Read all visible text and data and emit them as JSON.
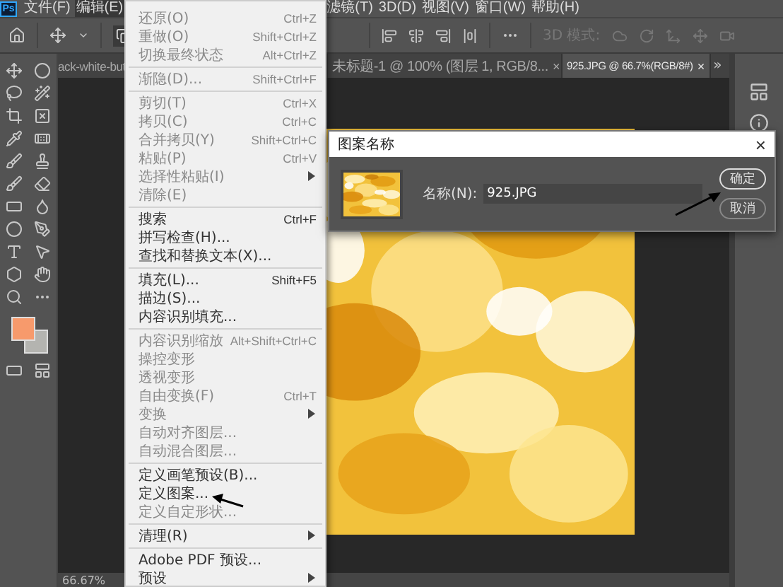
{
  "app_logo": "Ps",
  "menubar_left": [
    {
      "label": "文件(F)",
      "selected": false
    },
    {
      "label": "编辑(E)",
      "selected": true
    }
  ],
  "menubar_right": [
    {
      "label": "滤镜(T)",
      "selected": false
    },
    {
      "label": "3D(D)",
      "selected": false
    },
    {
      "label": "视图(V)",
      "selected": false
    },
    {
      "label": "窗口(W)",
      "selected": false
    },
    {
      "label": "帮助(H)",
      "selected": false
    }
  ],
  "options_bar": {
    "mode_label": "3D 模式:"
  },
  "tabs": [
    {
      "label": "ack-white-but",
      "selected": false
    },
    {
      "label": "未标题-1 @ 100% (图层 1, RGB/8...",
      "close": "×",
      "selected": false
    },
    {
      "label": "925.JPG @ 66.7%(RGB/8#)",
      "close": "×",
      "selected": true
    }
  ],
  "tab_overflow": "»",
  "status_bar": {
    "zoom": "66.67%"
  },
  "edit_menu": [
    {
      "kind": "item",
      "label": "还原(O)",
      "shortcut": "Ctrl+Z",
      "disabled": true
    },
    {
      "kind": "item",
      "label": "重做(O)",
      "shortcut": "Shift+Ctrl+Z",
      "disabled": true
    },
    {
      "kind": "item",
      "label": "切换最终状态",
      "shortcut": "Alt+Ctrl+Z",
      "disabled": true
    },
    {
      "kind": "separator"
    },
    {
      "kind": "item",
      "label": "渐隐(D)...",
      "shortcut": "Shift+Ctrl+F",
      "disabled": true
    },
    {
      "kind": "separator"
    },
    {
      "kind": "item",
      "label": "剪切(T)",
      "shortcut": "Ctrl+X",
      "disabled": true
    },
    {
      "kind": "item",
      "label": "拷贝(C)",
      "shortcut": "Ctrl+C",
      "disabled": true
    },
    {
      "kind": "item",
      "label": "合并拷贝(Y)",
      "shortcut": "Shift+Ctrl+C",
      "disabled": true
    },
    {
      "kind": "item",
      "label": "粘贴(P)",
      "shortcut": "Ctrl+V",
      "disabled": true
    },
    {
      "kind": "submenu",
      "label": "选择性粘贴(I)",
      "disabled": true
    },
    {
      "kind": "item",
      "label": "清除(E)",
      "disabled": true
    },
    {
      "kind": "separator"
    },
    {
      "kind": "item",
      "label": "搜索",
      "shortcut": "Ctrl+F",
      "disabled": false
    },
    {
      "kind": "item",
      "label": "拼写检查(H)...",
      "disabled": false
    },
    {
      "kind": "item",
      "label": "查找和替换文本(X)...",
      "disabled": false
    },
    {
      "kind": "separator"
    },
    {
      "kind": "item",
      "label": "填充(L)...",
      "shortcut": "Shift+F5",
      "disabled": false
    },
    {
      "kind": "item",
      "label": "描边(S)...",
      "disabled": false
    },
    {
      "kind": "item",
      "label": "内容识别填充...",
      "disabled": false
    },
    {
      "kind": "separator"
    },
    {
      "kind": "item",
      "label": "内容识别缩放",
      "shortcut": "Alt+Shift+Ctrl+C",
      "disabled": true
    },
    {
      "kind": "item",
      "label": "操控变形",
      "disabled": true
    },
    {
      "kind": "item",
      "label": "透视变形",
      "disabled": true
    },
    {
      "kind": "item",
      "label": "自由变换(F)",
      "shortcut": "Ctrl+T",
      "disabled": true
    },
    {
      "kind": "submenu",
      "label": "变换",
      "disabled": true
    },
    {
      "kind": "item",
      "label": "自动对齐图层...",
      "disabled": true
    },
    {
      "kind": "item",
      "label": "自动混合图层...",
      "disabled": true
    },
    {
      "kind": "separator"
    },
    {
      "kind": "item",
      "label": "定义画笔预设(B)...",
      "disabled": false
    },
    {
      "kind": "item",
      "label": "定义图案...",
      "disabled": false
    },
    {
      "kind": "item",
      "label": "定义自定形状...",
      "disabled": true
    },
    {
      "kind": "separator"
    },
    {
      "kind": "submenu",
      "label": "清理(R)",
      "disabled": false
    },
    {
      "kind": "separator"
    },
    {
      "kind": "item",
      "label": "Adobe PDF 预设...",
      "disabled": false
    },
    {
      "kind": "submenu",
      "label": "预设",
      "disabled": false
    }
  ],
  "dialog": {
    "title": "图案名称",
    "close": "×",
    "name_label": "名称(N):",
    "name_value": "925.JPG",
    "buttons": [
      {
        "label": "确定",
        "selected": true
      },
      {
        "label": "取消",
        "selected": false
      }
    ]
  }
}
